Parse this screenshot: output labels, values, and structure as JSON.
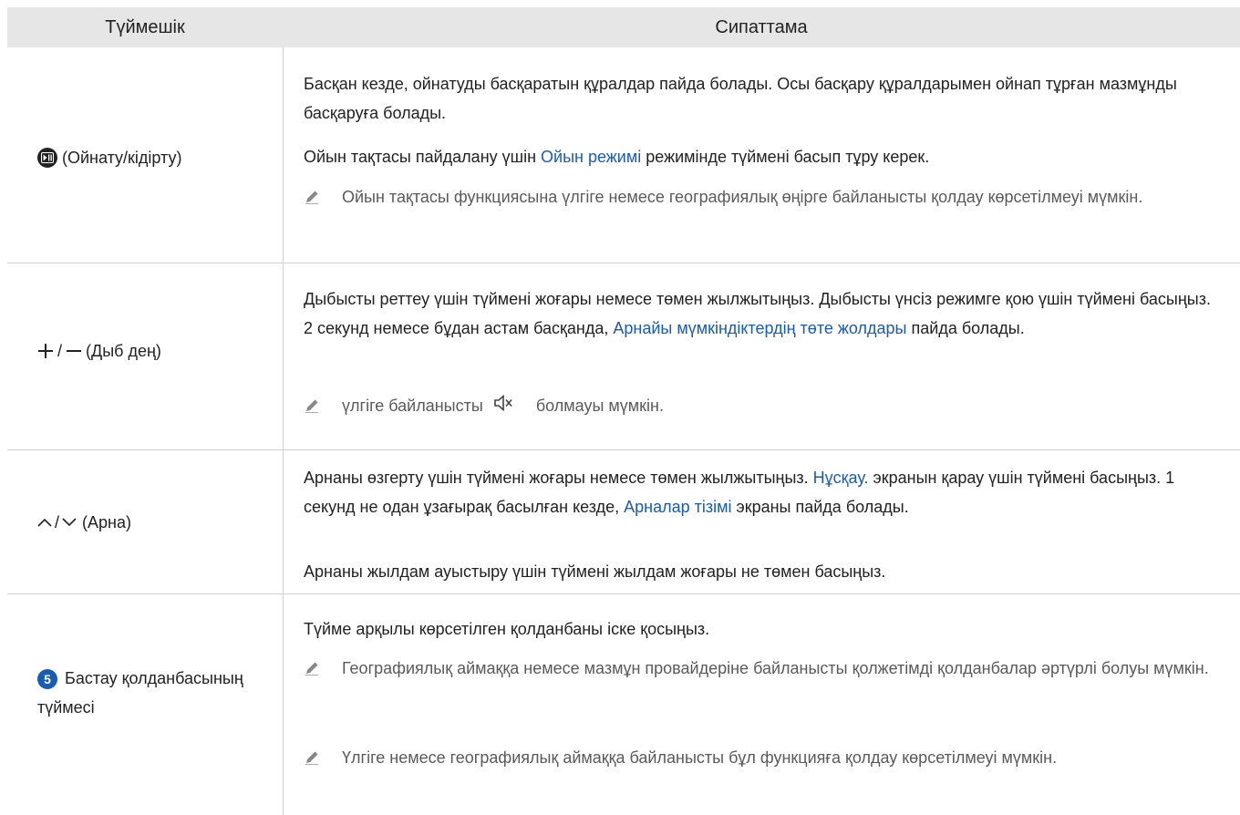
{
  "header": {
    "col1": "Түймешік",
    "col2": "Сипаттама"
  },
  "rows": [
    {
      "button_label": "(Ойнату/кідірту)",
      "icon": "play-pause-icon",
      "p1": "Басқан кезде, ойнатуды басқаратын құралдар пайда болады. Осы басқару құралдарымен ойнап тұрған мазмұнды басқаруға болады.",
      "p2_pre": "Ойын тақтасы пайдалану үшін ",
      "p2_link": "Ойын режимі",
      "p2_post": " режимінде түймені басып тұру керек.",
      "note": "Ойын тақтасы функциясына үлгіге немесе географиялық өңірге байланысты қолдау көрсетілмеуі мүмкін."
    },
    {
      "button_label": "(Дыб дең)",
      "icon": "plus-minus-icon",
      "p1_pre": "Дыбысты реттеу үшін түймені жоғары немесе төмен жылжытыңыз. Дыбысты үнсіз режимге қою үшін түймені басыңыз. 2 секунд немесе бұдан астам басқанда, ",
      "p1_link": "Арнайы мүмкіндіктердің төте жолдары",
      "p1_post": " пайда болады.",
      "note_pre": "үлгіге байланысты",
      "note_post": "болмауы мүмкін."
    },
    {
      "button_label": "(Арна)",
      "icon": "up-down-chevron-icon",
      "p1_pre": "Арнаны өзгерту үшін түймені жоғары немесе төмен жылжытыңыз. ",
      "p1_link1": "Нұсқау.",
      "p1_mid": " экранын қарау үшін түймені басыңыз. 1 секунд не одан ұзағырақ басылған кезде, ",
      "p1_link2": "Арналар тізімі",
      "p1_post": " экраны пайда болады.",
      "p2": "Арнаны жылдам ауыстыру үшін түймені жылдам жоғары не төмен басыңыз."
    },
    {
      "badge": "5",
      "button_label": "Бастау қолданбасының түймесі",
      "p1": "Түйме арқылы көрсетілген қолданбаны іске қосыңыз.",
      "note1": "Географиялық аймаққа немесе мазмұн провайдеріне байланысты қолжетімді қолданбалар әртүрлі болуы мүмкін.",
      "note2": "Үлгіге немесе географиялық аймаққа байланысты бұл функцияға қолдау көрсетілмеуі мүмкін."
    }
  ]
}
